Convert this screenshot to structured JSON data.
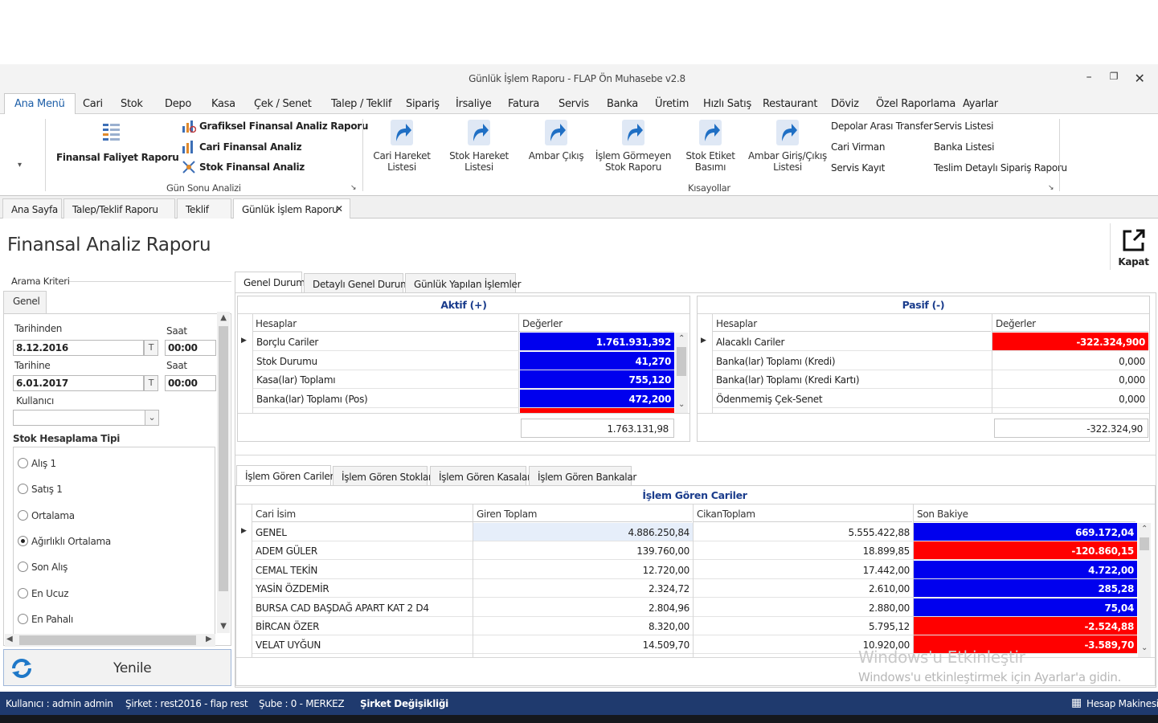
{
  "window": {
    "title": "Günlük İşlem Raporu - FLAP Ön Muhasebe v2.8"
  },
  "menu": [
    "Ana Menü",
    "Cari",
    "Stok",
    "Depo",
    "Kasa",
    "Çek / Senet",
    "Talep / Teklif",
    "Sipariş",
    "İrsaliye",
    "Fatura",
    "Servis",
    "Banka",
    "Üretim",
    "Hızlı Satış",
    "Restaurant",
    "Döviz",
    "Özel Raporlama",
    "Ayarlar"
  ],
  "ribbon": {
    "faaliyet": "Finansal Faliyet Raporu",
    "grafik": "Grafiksel Finansal Analiz Raporu",
    "cari_analiz": "Cari Finansal Analiz",
    "stok_analiz": "Stok Finansal Analiz",
    "group1": "Gün Sonu Analizi",
    "shortcuts": [
      "Cari Hareket\nListesi",
      "Stok Hareket\nListesi",
      "Ambar Çıkış",
      "İşlem Görmeyen\nStok Raporu",
      "Stok Etiket\nBasımı",
      "Ambar Giriş/Çıkış\nListesi"
    ],
    "group2": "Kısayollar",
    "links_a": [
      "Depolar Arası Transfer",
      "Cari Virman",
      "Servis Kayıt"
    ],
    "links_b": [
      "Servis Listesi",
      "Banka Listesi",
      "Teslim Detaylı Sipariş Raporu"
    ]
  },
  "doctabs": [
    "Ana Sayfa",
    "Talep/Teklif Raporu",
    "Teklif",
    "Günlük İşlem Raporu"
  ],
  "page": {
    "title": "Finansal Analiz Raporu",
    "close_label": "Kapat"
  },
  "search": {
    "group": "Arama Kriteri",
    "tab": "Genel",
    "from_label": "Tarihinden",
    "from_date": "8.12.2016",
    "to_label": "Tarihine",
    "to_date": "6.01.2017",
    "time_label": "Saat",
    "from_time": "00:00",
    "to_time": "00:00",
    "t_btn": "T",
    "user_label": "Kullanıcı",
    "stock_label": "Stok Hesaplama Tipi",
    "options": [
      "Alış 1",
      "Satış 1",
      "Ortalama",
      "Ağırlıklı Ortalama",
      "Son Alış",
      "En Ucuz",
      "En Pahalı"
    ],
    "selected_option": 3,
    "refresh": "Yenile"
  },
  "main_tabs": [
    "Genel Durum",
    "Detaylı Genel Durum",
    "Günlük Yapılan İşlemler"
  ],
  "aktif": {
    "title": "Aktif (+)",
    "col1": "Hesaplar",
    "col2": "Değerler",
    "rows": [
      {
        "name": "Borçlu Cariler",
        "value": "1.761.931,392",
        "color": "blue"
      },
      {
        "name": "Stok Durumu",
        "value": "41,270",
        "color": "blue"
      },
      {
        "name": "Kasa(lar) Toplamı",
        "value": "755,120",
        "color": "blue"
      },
      {
        "name": "Banka(lar) Toplamı (Pos)",
        "value": "472,200",
        "color": "blue"
      }
    ],
    "total": "1.763.131,98"
  },
  "pasif": {
    "title": "Pasif (-)",
    "col1": "Hesaplar",
    "col2": "Değerler",
    "rows": [
      {
        "name": "Alacaklı Cariler",
        "value": "-322.324,900",
        "color": "red"
      },
      {
        "name": "Banka(lar) Toplamı (Kredi)",
        "value": "0,000",
        "color": ""
      },
      {
        "name": "Banka(lar) Toplamı (Kredi Kartı)",
        "value": "0,000",
        "color": ""
      },
      {
        "name": "Ödenmemiş Çek-Senet",
        "value": "0,000",
        "color": ""
      }
    ],
    "total": "-322.324,90"
  },
  "lower_tabs": [
    "İşlem Gören Cariler",
    "İşlem Gören Stoklar",
    "İşlem Gören Kasalar",
    "İşlem Gören Bankalar"
  ],
  "cariler": {
    "title": "İşlem Gören Cariler",
    "columns": [
      "Cari İsim",
      "Giren Toplam",
      "CikanToplam",
      "Son Bakiye"
    ],
    "rows": [
      {
        "name": "GENEL",
        "giren": "4.886.250,84",
        "cikan": "5.555.422,88",
        "bakiye": "669.172,04",
        "color": "blue"
      },
      {
        "name": "ADEM GÜLER",
        "giren": "139.760,00",
        "cikan": "18.899,85",
        "bakiye": "-120.860,15",
        "color": "red"
      },
      {
        "name": "CEMAL TEKİN",
        "giren": "12.720,00",
        "cikan": "17.442,00",
        "bakiye": "4.722,00",
        "color": "blue"
      },
      {
        "name": "YASİN ÖZDEMİR",
        "giren": "2.324,72",
        "cikan": "2.610,00",
        "bakiye": "285,28",
        "color": "blue"
      },
      {
        "name": "BURSA CAD BAŞDAĞ APART KAT 2 D4",
        "giren": "2.804,96",
        "cikan": "2.880,00",
        "bakiye": "75,04",
        "color": "blue"
      },
      {
        "name": "BİRCAN ÖZER",
        "giren": "8.320,00",
        "cikan": "5.795,12",
        "bakiye": "-2.524,88",
        "color": "red"
      },
      {
        "name": "VELAT UYĞUN",
        "giren": "14.509,70",
        "cikan": "10.920,00",
        "bakiye": "-3.589,70",
        "color": "red"
      }
    ]
  },
  "status": {
    "user": "Kullanıcı : admin admin",
    "company": "Şirket : rest2016 - flap rest",
    "branch": "Şube : 0 - MERKEZ",
    "change": "Şirket Değişikliği",
    "calc": "Hesap Makinesi"
  },
  "watermark": {
    "line1": "Windows'u Etkinleştir",
    "line2": "Windows'u etkinleştirmek için Ayarlar'a gidin."
  },
  "colors": {
    "blue": "#0000ee",
    "red": "#ff0000",
    "status_bar": "#1f3a6e",
    "accent": "#1e5fa8"
  }
}
